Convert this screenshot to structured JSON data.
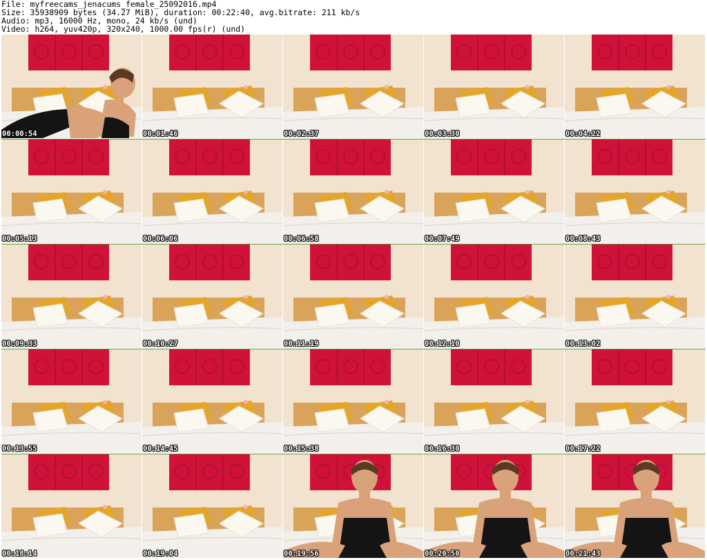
{
  "header": {
    "file_line": "File: myfreecams_jenacums_female_25092016.mp4",
    "size_line": "Size: 35938909 bytes (34.27 MiB), duration: 00:22:40, avg.bitrate: 211 kb/s",
    "audio_line": "Audio: mp3, 16000 Hz, mono, 24 kb/s (und)",
    "video_line": "Video: h264, yuv420p, 320x240, 1000.00 fps(r) (und)"
  },
  "colors": {
    "wall": "#f2e3d0",
    "art": "#d0123a",
    "headboard": "#d9a35a",
    "bed": "#f3f0ec",
    "pillow_gold": "#e5a628",
    "pillow_white": "#fbf8f0",
    "person_skin": "#d9a27a",
    "person_dress": "#141414",
    "separator": "#5aa02c"
  },
  "thumbnails": [
    {
      "time": "00:00:54",
      "scene": "person-lying"
    },
    {
      "time": "00:01:46",
      "scene": "empty-bed"
    },
    {
      "time": "00:02:37",
      "scene": "empty-bed"
    },
    {
      "time": "00:03:30",
      "scene": "empty-bed"
    },
    {
      "time": "00:04:22",
      "scene": "empty-bed"
    },
    {
      "time": "00:05:13",
      "scene": "empty-bed"
    },
    {
      "time": "00:06:06",
      "scene": "empty-bed"
    },
    {
      "time": "00:06:58",
      "scene": "empty-bed"
    },
    {
      "time": "00:07:49",
      "scene": "empty-bed"
    },
    {
      "time": "00:08:43",
      "scene": "empty-bed"
    },
    {
      "time": "00:09:33",
      "scene": "empty-bed"
    },
    {
      "time": "00:10:27",
      "scene": "empty-bed"
    },
    {
      "time": "00:11:19",
      "scene": "empty-bed"
    },
    {
      "time": "00:12:10",
      "scene": "empty-bed"
    },
    {
      "time": "00:13:02",
      "scene": "empty-bed"
    },
    {
      "time": "00:13:55",
      "scene": "empty-bed"
    },
    {
      "time": "00:14:45",
      "scene": "empty-bed"
    },
    {
      "time": "00:15:38",
      "scene": "empty-bed"
    },
    {
      "time": "00:16:30",
      "scene": "empty-bed"
    },
    {
      "time": "00:17:22",
      "scene": "empty-bed"
    },
    {
      "time": "00:18:14",
      "scene": "empty-bed"
    },
    {
      "time": "00:19:04",
      "scene": "empty-bed"
    },
    {
      "time": "00:19:56",
      "scene": "person-seated"
    },
    {
      "time": "00:20:50",
      "scene": "person-seated"
    },
    {
      "time": "00:21:43",
      "scene": "person-seated"
    }
  ]
}
